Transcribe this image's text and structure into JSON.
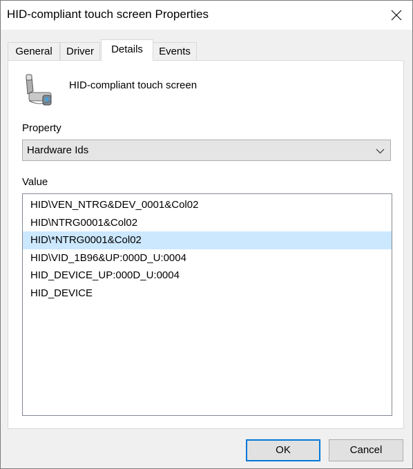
{
  "window": {
    "title": "HID-compliant touch screen Properties"
  },
  "tabs": [
    {
      "label": "General"
    },
    {
      "label": "Driver"
    },
    {
      "label": "Details"
    },
    {
      "label": "Events"
    }
  ],
  "active_tab": "Details",
  "device": {
    "name": "HID-compliant touch screen",
    "icon": "touch-screen-device-icon"
  },
  "property": {
    "label": "Property",
    "selected": "Hardware Ids"
  },
  "value": {
    "label": "Value",
    "items": [
      "HID\\VEN_NTRG&DEV_0001&Col02",
      "HID\\NTRG0001&Col02",
      "HID\\*NTRG0001&Col02",
      "HID\\VID_1B96&UP:000D_U:0004",
      "HID_DEVICE_UP:000D_U:0004",
      "HID_DEVICE"
    ],
    "selected_index": 2
  },
  "buttons": {
    "ok": "OK",
    "cancel": "Cancel"
  },
  "colors": {
    "selection": "#cce8ff",
    "accent": "#0078d7"
  }
}
